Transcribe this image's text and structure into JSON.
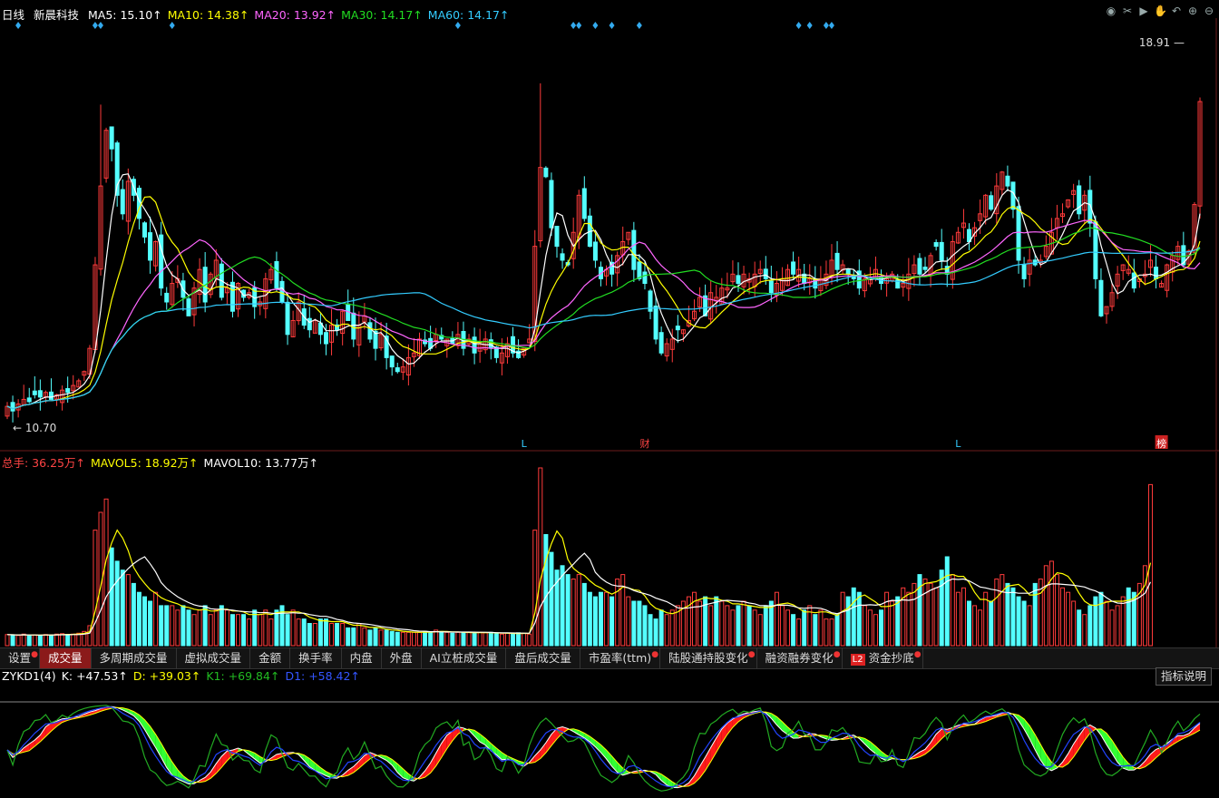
{
  "header": {
    "period": "日线",
    "stock_name": "新晨科技",
    "ma": [
      {
        "label": "MA5: 15.10",
        "color": "#ffffff"
      },
      {
        "label": "MA10: 14.38",
        "color": "#ffff00"
      },
      {
        "label": "MA20: 13.92",
        "color": "#ff66ff"
      },
      {
        "label": "MA30: 14.17",
        "color": "#22dd22"
      },
      {
        "label": "MA60: 14.17",
        "color": "#33ccff"
      }
    ],
    "arrow": "↑"
  },
  "toolbar_icons": [
    "eye-icon",
    "scissors-icon",
    "play-icon",
    "hand-icon",
    "undo-icon",
    "zoom-in-icon",
    "zoom-out-icon"
  ],
  "price_panel": {
    "high_label": "18.91",
    "low_label": "10.70",
    "markers": [
      {
        "text": "L",
        "color": "#33ccff",
        "i": 94
      },
      {
        "text": "财",
        "color": "#ff4444",
        "i": 116
      },
      {
        "text": "L",
        "color": "#33ccff",
        "i": 173
      },
      {
        "text": "榜",
        "color": "#ffffff",
        "bg": "#cc2222",
        "i": 210
      }
    ]
  },
  "volume_panel": {
    "legend": [
      {
        "label": "总手: 36.25万",
        "color": "#ff4444"
      },
      {
        "label": "MAVOL5: 18.92万",
        "color": "#ffff00"
      },
      {
        "label": "MAVOL10: 13.77万",
        "color": "#ffffff"
      }
    ]
  },
  "tabs": [
    {
      "label": "设置",
      "dot": true
    },
    {
      "label": "成交量",
      "active": true
    },
    {
      "label": "多周期成交量"
    },
    {
      "label": "虚拟成交量"
    },
    {
      "label": "金额"
    },
    {
      "label": "换手率"
    },
    {
      "label": "内盘"
    },
    {
      "label": "外盘"
    },
    {
      "label": "AI立桩成交量"
    },
    {
      "label": "盘后成交量"
    },
    {
      "label": "市盈率(ttm)",
      "dot": true
    },
    {
      "label": "陆股通持股变化",
      "dot": true
    },
    {
      "label": "融资融券变化",
      "dot": true
    },
    {
      "label": "资金抄底",
      "badge": "L2",
      "dot": true
    }
  ],
  "indicator_panel": {
    "legend": [
      {
        "label": "ZYKD1(4)",
        "color": "#ffffff"
      },
      {
        "label": "K: +47.53",
        "color": "#ffffff"
      },
      {
        "label": "D: +39.03",
        "color": "#ffff00"
      },
      {
        "label": "K1: +69.84",
        "color": "#22bb22"
      },
      {
        "label": "D1: +58.42",
        "color": "#3355ff"
      }
    ],
    "explain_button": "指标说明"
  },
  "chart_data": {
    "type": "candlestick",
    "y_range": [
      10.7,
      18.91
    ],
    "closes": [
      11.05,
      10.95,
      11.1,
      11.2,
      11.15,
      11.3,
      11.25,
      11.35,
      11.2,
      11.3,
      11.4,
      11.35,
      11.5,
      11.6,
      11.8,
      12.3,
      14.1,
      15.8,
      17.0,
      16.6,
      15.6,
      15.2,
      15.9,
      15.6,
      15.1,
      14.7,
      14.2,
      14.6,
      13.6,
      13.3,
      13.7,
      13.8,
      13.4,
      13.0,
      13.6,
      14.0,
      13.3,
      13.9,
      14.2,
      13.4,
      13.6,
      13.1,
      13.7,
      13.4,
      13.5,
      13.2,
      13.3,
      13.8,
      14.0,
      13.6,
      13.3,
      12.6,
      12.9,
      13.3,
      12.8,
      12.7,
      12.9,
      12.6,
      12.4,
      12.8,
      12.7,
      13.1,
      12.9,
      12.5,
      12.8,
      13.0,
      12.5,
      12.3,
      12.6,
      12.1,
      11.9,
      11.8,
      11.9,
      12.1,
      12.2,
      12.5,
      12.4,
      12.3,
      12.6,
      12.5,
      12.5,
      12.4,
      12.6,
      12.3,
      12.5,
      12.2,
      12.4,
      12.5,
      12.3,
      12.1,
      12.2,
      12.4,
      12.2,
      12.1,
      12.3,
      12.5,
      14.5,
      16.2,
      16.0,
      14.9,
      14.5,
      14.2,
      14.1,
      14.8,
      15.6,
      15.1,
      14.5,
      14.2,
      13.8,
      14.0,
      13.9,
      14.3,
      14.6,
      14.8,
      14.0,
      13.8,
      13.7,
      13.1,
      12.5,
      12.2,
      12.4,
      12.5,
      12.7,
      12.7,
      12.9,
      13.1,
      13.4,
      13.0,
      13.5,
      13.4,
      13.6,
      13.6,
      13.9,
      13.7,
      13.9,
      13.8,
      13.9,
      14.0,
      13.8,
      13.5,
      13.7,
      13.8,
      14.0,
      13.9,
      14.0,
      13.7,
      13.8,
      13.6,
      13.8,
      13.9,
      14.2,
      14.0,
      14.1,
      13.9,
      13.8,
      13.6,
      13.8,
      13.8,
      14.0,
      13.7,
      13.8,
      13.9,
      13.6,
      13.7,
      13.9,
      14.1,
      13.9,
      14.0,
      14.3,
      14.5,
      14.2,
      13.9,
      14.6,
      14.8,
      15.0,
      14.6,
      14.9,
      15.2,
      15.6,
      15.3,
      15.8,
      16.1,
      15.8,
      15.3,
      14.2,
      13.8,
      14.2,
      14.1,
      14.2,
      14.5,
      14.8,
      15.1,
      15.2,
      15.5,
      15.7,
      15.2,
      15.6,
      15.0,
      13.8,
      13.0,
      13.2,
      13.5,
      13.9,
      14.1,
      14.0,
      13.6,
      13.8,
      13.9,
      14.2,
      13.8,
      13.7,
      14.1,
      14.3,
      14.5,
      14.1,
      14.4,
      15.4,
      17.62
    ],
    "volumes": [
      2.5,
      2.4,
      2.3,
      2.6,
      2.2,
      2.4,
      2.3,
      2.5,
      2.4,
      2.6,
      2.7,
      2.5,
      2.6,
      2.8,
      3.2,
      4.5,
      26,
      30,
      33,
      22,
      19,
      17,
      16,
      14,
      12,
      11,
      10,
      12,
      9,
      9,
      9,
      8,
      9,
      8,
      7,
      8,
      9,
      7,
      8,
      9,
      8,
      7,
      7,
      7,
      6,
      8,
      7,
      8,
      6,
      8,
      9,
      7,
      8,
      6,
      6,
      5,
      5,
      6,
      6,
      5,
      5,
      5,
      4,
      4,
      5,
      4,
      3.5,
      4,
      3.5,
      3.5,
      3.2,
      3,
      3,
      3,
      3,
      3,
      3.2,
      3,
      3.5,
      3.2,
      3,
      2.8,
      3,
      3,
      3,
      2.8,
      3,
      2.9,
      3,
      2.7,
      2.6,
      2.8,
      2.7,
      2.9,
      2.8,
      2.6,
      26,
      40,
      25,
      21,
      17,
      18,
      16,
      15,
      16,
      14,
      12,
      11,
      12,
      12,
      11,
      15,
      16,
      11,
      10,
      10,
      9,
      7,
      6,
      8,
      7,
      8,
      9,
      10,
      11,
      12,
      10,
      11,
      9,
      11,
      10,
      9,
      8,
      9,
      10,
      9,
      8,
      7,
      9,
      10,
      12,
      9,
      8,
      7,
      6,
      8,
      9,
      7,
      8,
      6,
      6,
      7,
      12,
      11,
      13,
      12,
      9,
      8,
      7,
      8,
      12,
      10,
      11,
      13,
      12,
      14,
      16,
      15,
      14,
      13,
      17,
      20,
      16,
      12,
      13,
      10,
      9,
      8,
      12,
      10,
      15,
      16,
      14,
      13,
      11,
      10,
      9,
      14,
      15,
      18,
      19,
      16,
      13,
      12,
      10,
      8,
      7,
      9,
      11,
      12,
      10,
      8,
      9,
      11,
      13,
      12,
      14,
      18,
      36.25
    ]
  }
}
